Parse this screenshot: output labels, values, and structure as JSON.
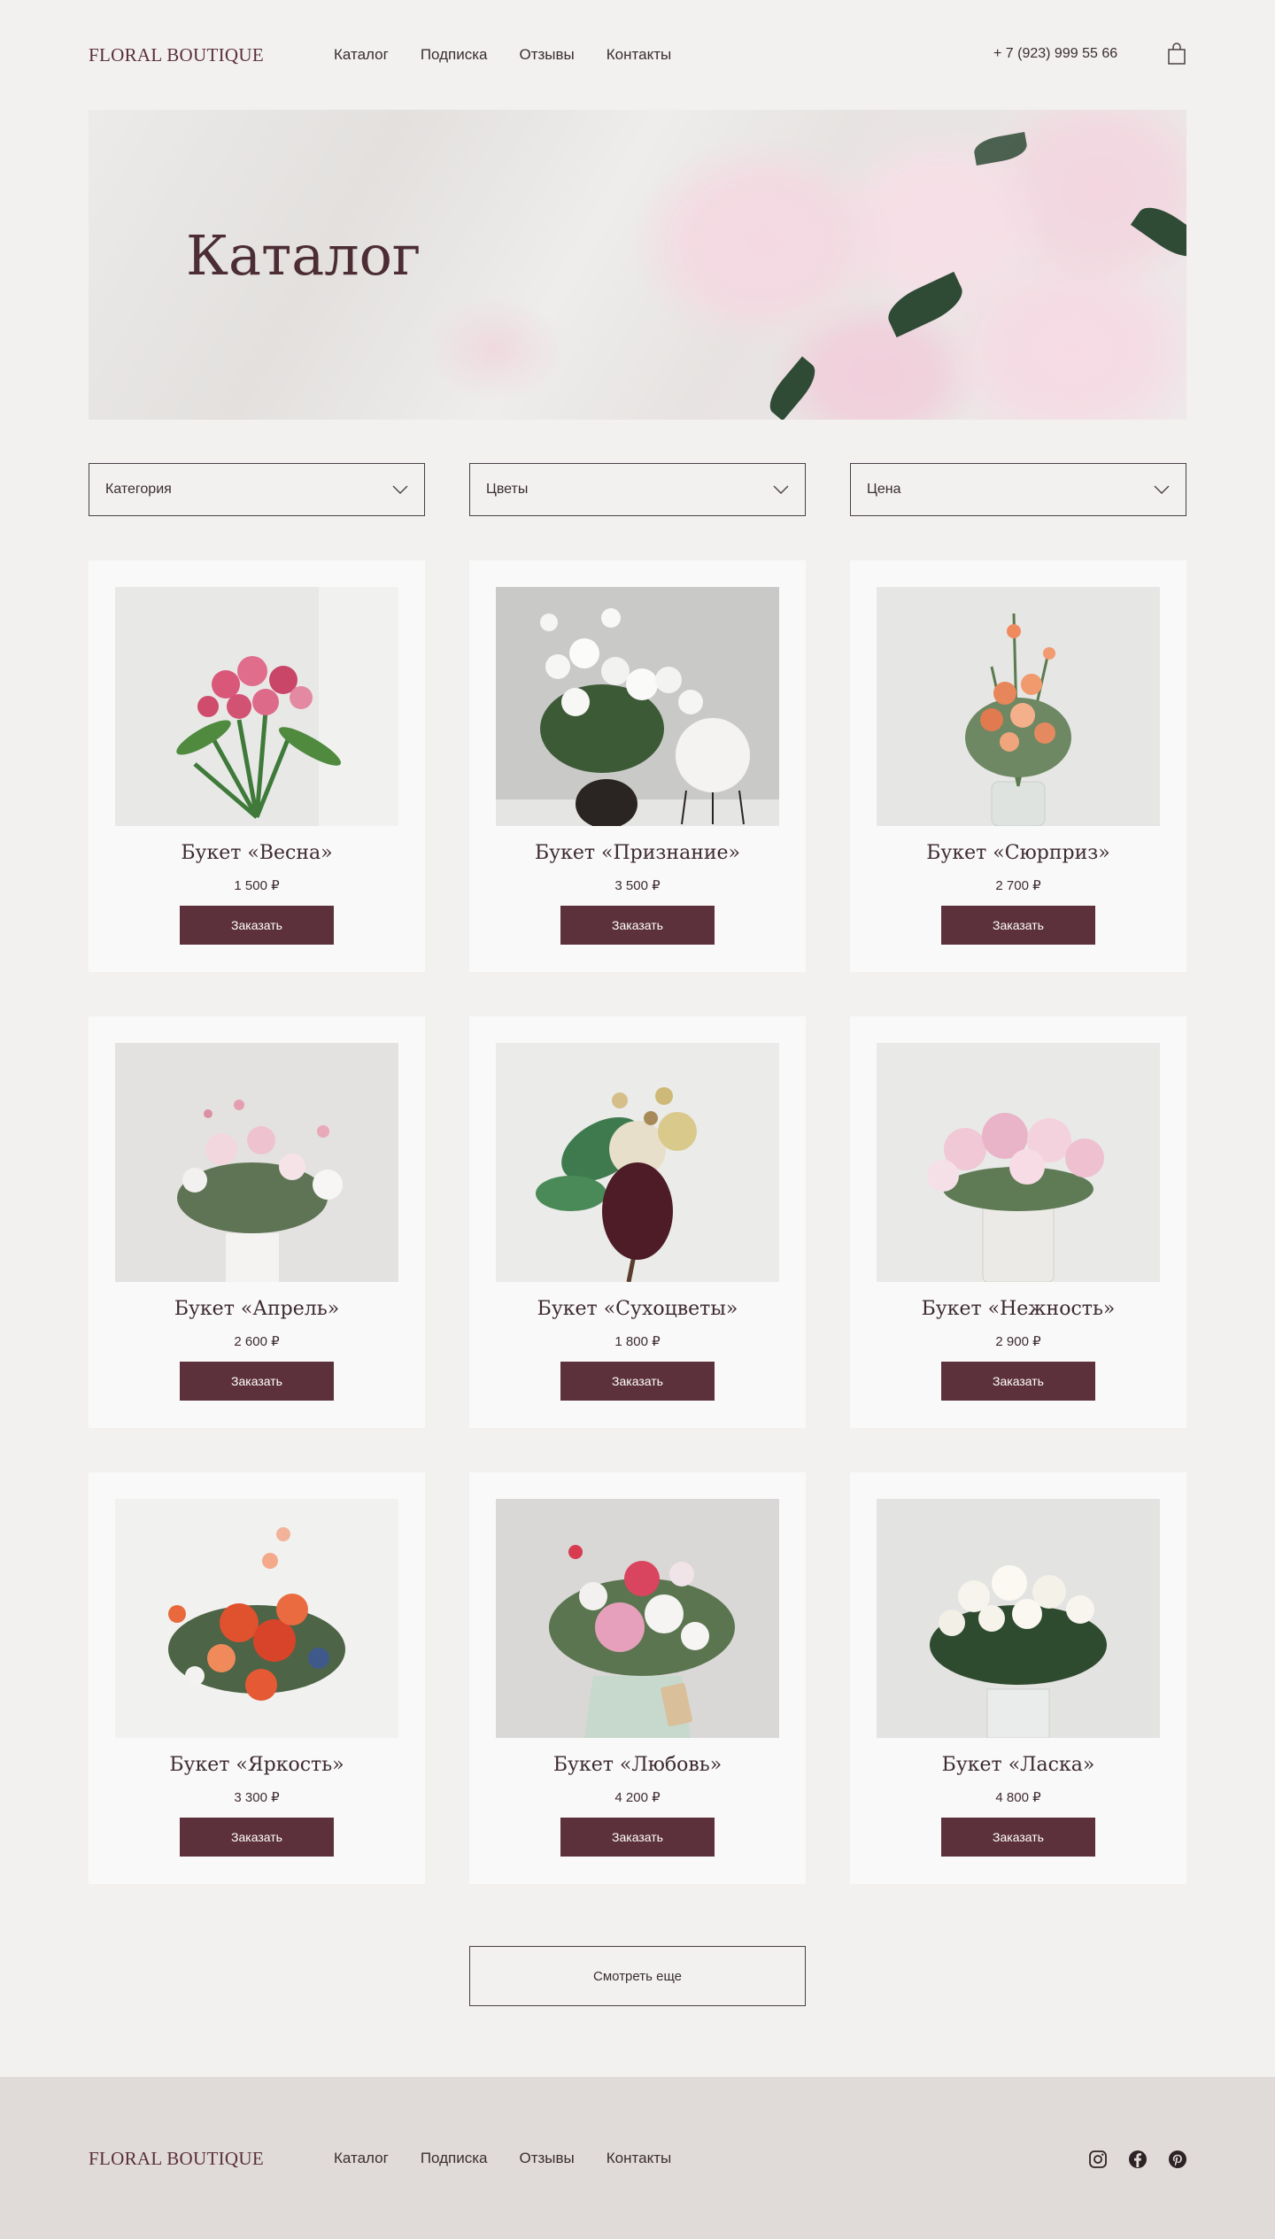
{
  "header": {
    "logo": "FLORAL BOUTIQUE",
    "nav": [
      "Каталог",
      "Подписка",
      "Отзывы",
      "Контакты"
    ],
    "phone": "+ 7 (923) 999 55 66",
    "cart_icon": "shopping-bag-icon"
  },
  "hero": {
    "title": "Каталог"
  },
  "filters": [
    {
      "label": "Категория",
      "icon": "chevron-down-icon"
    },
    {
      "label": "Цветы",
      "icon": "chevron-down-icon"
    },
    {
      "label": "Цена",
      "icon": "chevron-down-icon"
    }
  ],
  "products": [
    {
      "name": "Букет «Весна»",
      "price": "1 500 ₽",
      "button": "Заказать"
    },
    {
      "name": "Букет «Признание»",
      "price": "3 500 ₽",
      "button": "Заказать"
    },
    {
      "name": "Букет «Сюрприз»",
      "price": "2 700 ₽",
      "button": "Заказать"
    },
    {
      "name": "Букет «Апрель»",
      "price": "2 600 ₽",
      "button": "Заказать"
    },
    {
      "name": "Букет «Сухоцветы»",
      "price": "1 800 ₽",
      "button": "Заказать"
    },
    {
      "name": "Букет «Нежность»",
      "price": "2 900 ₽",
      "button": "Заказать"
    },
    {
      "name": "Букет «Яркость»",
      "price": "3 300 ₽",
      "button": "Заказать"
    },
    {
      "name": "Букет «Любовь»",
      "price": "4 200 ₽",
      "button": "Заказать"
    },
    {
      "name": "Букет «Ласка»",
      "price": "4 800 ₽",
      "button": "Заказать"
    }
  ],
  "more_button": "Смотреть еще",
  "footer": {
    "logo": "FLORAL BOUTIQUE",
    "nav": [
      "Каталог",
      "Подписка",
      "Отзывы",
      "Контакты"
    ],
    "social_icons": [
      "instagram-icon",
      "facebook-icon",
      "pinterest-icon"
    ]
  },
  "colors": {
    "background": "#f2f1f0",
    "card": "#f9f9f9",
    "accent": "#5c313b",
    "logo": "#5a2f3a",
    "footer": "#e0dbd8"
  }
}
